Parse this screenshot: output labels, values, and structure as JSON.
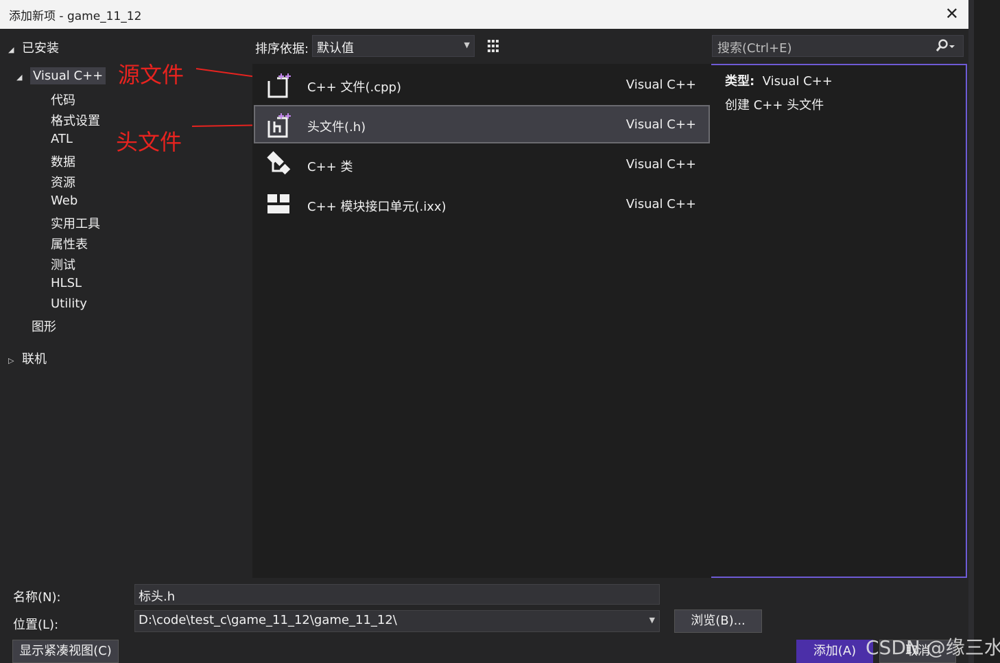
{
  "window": {
    "title": "添加新项 - game_11_12"
  },
  "tree": {
    "installed": "已安装",
    "visual_cpp": "Visual C++",
    "children": [
      "代码",
      "格式设置",
      "ATL",
      "数据",
      "资源",
      "Web",
      "实用工具",
      "属性表",
      "测试",
      "HLSL",
      "Utility"
    ],
    "graphics": "图形",
    "online": "联机"
  },
  "annotations": {
    "source_file": "源文件",
    "header_file": "头文件"
  },
  "toolbar": {
    "sort_label": "排序依据:",
    "sort_value": "默认值"
  },
  "templates": [
    {
      "name": "C++ 文件(.cpp)",
      "lang": "Visual C++",
      "icon": "cpp-file-icon"
    },
    {
      "name": "头文件(.h)",
      "lang": "Visual C++",
      "icon": "header-file-icon"
    },
    {
      "name": "C++ 类",
      "lang": "Visual C++",
      "icon": "cpp-class-icon"
    },
    {
      "name": "C++ 模块接口单元(.ixx)",
      "lang": "Visual C++",
      "icon": "module-interface-icon"
    }
  ],
  "search": {
    "placeholder": "搜索(Ctrl+E)"
  },
  "details": {
    "type_label": "类型:",
    "type_value": "Visual C++",
    "description": "创建 C++ 头文件"
  },
  "form": {
    "name_label": "名称(N):",
    "name_value": "标头.h",
    "location_label": "位置(L):",
    "location_value": "D:\\code\\test_c\\game_11_12\\game_11_12\\",
    "browse": "浏览(B)...",
    "compact": "显示紧凑视图(C)",
    "add": "添加(A)",
    "cancel": "取消"
  },
  "watermark": "CSDN @缘三水",
  "colors": {
    "accent": "#6e5bd6",
    "annotation_red": "#e8231f",
    "primary_button": "#4b2fa8"
  }
}
